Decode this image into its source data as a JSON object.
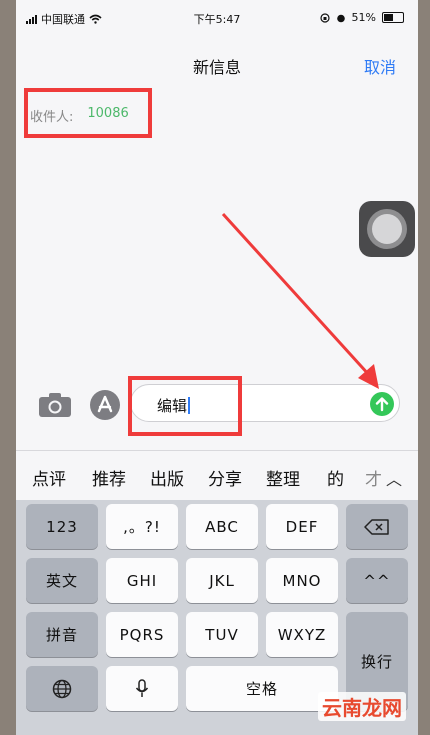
{
  "status_bar": {
    "carrier": "中国联通",
    "time": "下午5:47",
    "battery": "51%"
  },
  "nav": {
    "title": "新信息",
    "cancel": "取消"
  },
  "recipient": {
    "label": "收件人:",
    "number": "10086"
  },
  "compose": {
    "text": "编辑"
  },
  "candidates": [
    "点评",
    "推荐",
    "出版",
    "分享",
    "整理",
    "的",
    "才"
  ],
  "keyboard": {
    "row1": [
      "123",
      ",。?!",
      "ABC",
      "DEF"
    ],
    "row2": [
      "英文",
      "GHI",
      "JKL",
      "MNO",
      "^^"
    ],
    "row3": [
      "拼音",
      "PQRS",
      "TUV",
      "WXYZ",
      "换行"
    ],
    "row4": {
      "space": "空格"
    }
  },
  "annotation_color": "#ef3b3b",
  "watermark": "云南龙网"
}
